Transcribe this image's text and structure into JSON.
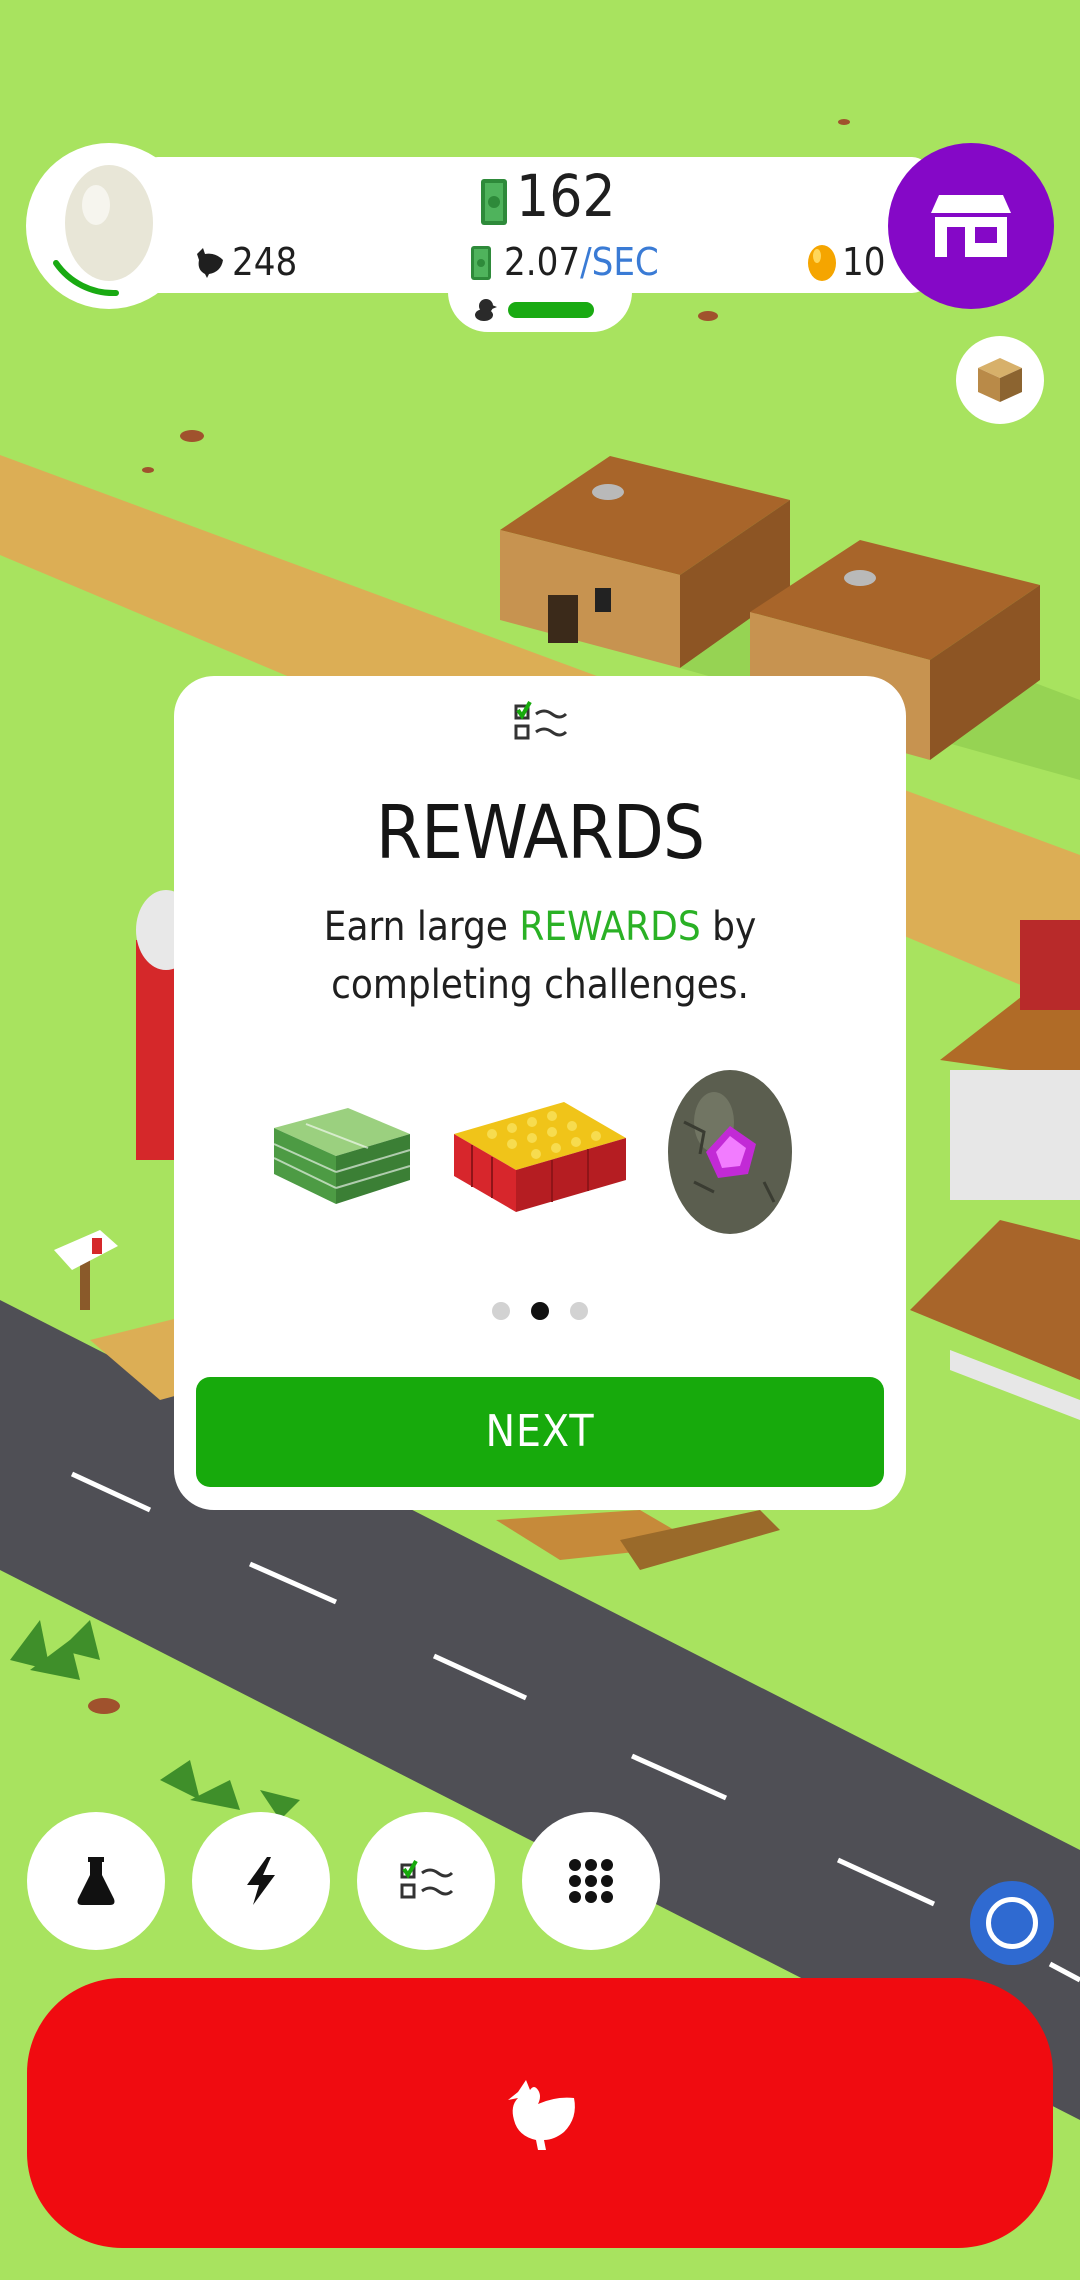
{
  "hud": {
    "money_total": "162",
    "rate_value": "2.07",
    "rate_unit": "/SEC",
    "chicken_count": "248",
    "golden_eggs": "10",
    "hatchery_progress": 0.9
  },
  "modal": {
    "title": "REWARDS",
    "description_before": "Earn large ",
    "description_highlight": "REWARDS",
    "description_after": " by completing challenges.",
    "rewards": [
      "cash-stack",
      "egg-crate",
      "dragon-egg"
    ],
    "page_dots": {
      "count": 3,
      "active_index": 1
    },
    "next_label": "NEXT"
  },
  "bottom_buttons": [
    {
      "name": "research",
      "icon": "flask-icon"
    },
    {
      "name": "boost",
      "icon": "lightning-icon"
    },
    {
      "name": "challenges",
      "icon": "checklist-icon"
    },
    {
      "name": "menu",
      "icon": "grid-icon"
    }
  ],
  "hatch_button": {
    "icon": "chicken-icon"
  },
  "colors": {
    "grass": "#a8e35f",
    "shop": "#8508c7",
    "hatch": "#f00b10",
    "next": "#17aa0c",
    "accent_text": "#2ab125",
    "rate_unit": "#3a7bd5"
  }
}
